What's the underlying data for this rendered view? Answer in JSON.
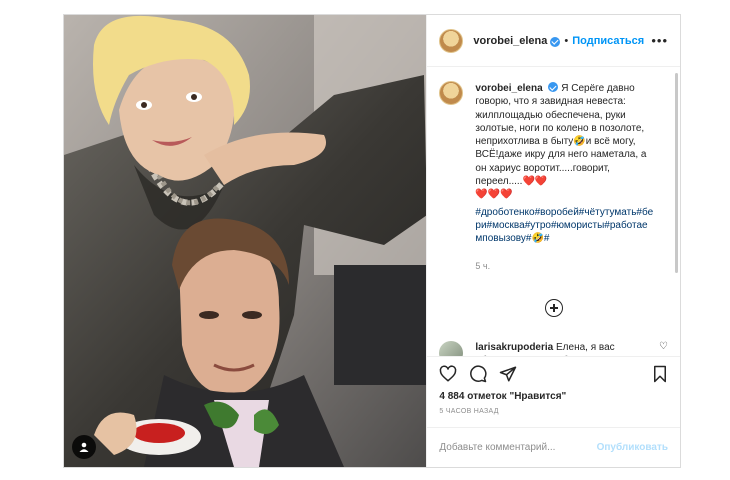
{
  "header": {
    "username": "vorobei_elena",
    "separator": "•",
    "follow_label": "Подписаться",
    "more_label": "•••"
  },
  "caption": {
    "username": "vorobei_elena",
    "text": "Я Серёге давно говорю, что я завидная невеста: жилплощадью обеспечена, руки золотые, ноги по колено в позолоте, неприхотлива в быту🤣и всё могу, ВСЁ!даже икру для него наметала, а он хариус воротит.....говорит, переел.....❤️❤️",
    "hearts": "❤️❤️❤️",
    "hashtags": "#дроботенко#воробей#чётутумать#бери#москва#утро#юмористы#работаемповызову#🤣#",
    "time_ago": "5 ч."
  },
  "comment": {
    "username": "larisakrupoderia",
    "text": "Елена, я вас обожаю.. не стоит бороться за"
  },
  "icons": {
    "like": "heart-icon",
    "comment": "comment-icon",
    "share": "paper-plane-icon",
    "save": "bookmark-icon",
    "load_more": "plus-circle-icon",
    "verified": "verified-badge-icon",
    "tagged_users": "user-tag-icon"
  },
  "likes": {
    "count": "4 884",
    "text": "отметок \"Нравится\""
  },
  "posted_ago": "5 ЧАСОВ НАЗАД",
  "add_comment": {
    "placeholder": "Добавьте комментарий...",
    "publish_label": "Опубликовать"
  },
  "colors": {
    "accent": "#0095f6",
    "hashtag": "#00376b",
    "publish_disabled": "#b2dffc",
    "muted": "#8e8e8e"
  }
}
